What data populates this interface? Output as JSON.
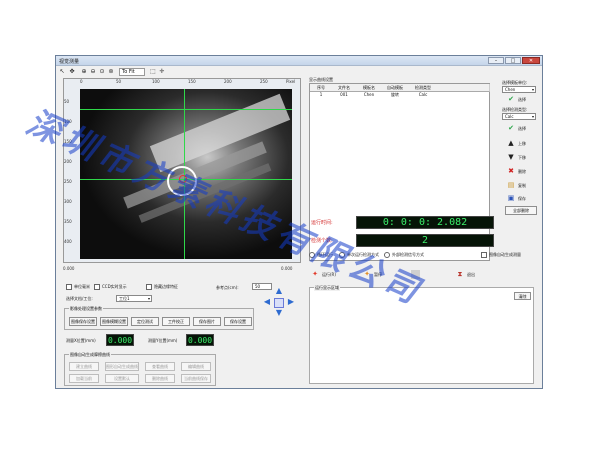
{
  "window": {
    "title": "视觉测量"
  },
  "toolbar": {
    "zoom_value": "To Fit"
  },
  "image": {
    "ruler_top": [
      "0",
      "50",
      "100",
      "150",
      "200",
      "250",
      "Pixel"
    ],
    "ruler_left": [
      "50",
      "100",
      "150",
      "200",
      "250",
      "300",
      "350",
      "400"
    ],
    "coords_left": "0.000",
    "coords_right": "0.000"
  },
  "left_panel": {
    "chk_unit": "单位毫米",
    "chk_ccd_display": "CCD实时显示",
    "chk_edge": "隐藏边缘特征",
    "ref_label": "参考点(cm):",
    "ref_value": "50",
    "select_label": "选择文档/工位:",
    "select_value": "工位1",
    "group1_title": "影像处理设置参数",
    "buttons_row1": [
      "图像保存设置",
      "图像模糊设置",
      "定位测试",
      "工件校正",
      "保存图片",
      "保存设置"
    ],
    "measure_x_label": "测量X位置(mm)",
    "measure_x_value": "0.000",
    "measure_y_label": "测量Y位置(mm)",
    "measure_y_value": "0.000",
    "group2_title": "图像自动生成摩擦曲线",
    "buttons_row2": [
      "建立曲线",
      "图形自动生成曲线",
      "查看曲线",
      "编辑曲线"
    ],
    "buttons_row3": [
      "加载当前",
      "设置默认",
      "删除曲线",
      "当前曲线保存"
    ]
  },
  "right_panel": {
    "table_title": "显示曲线设置",
    "columns": [
      "序号",
      "文件名",
      "模板名",
      "自动模板",
      "检测类型"
    ],
    "rows": [
      [
        "1",
        "001",
        "Chen",
        "旋转",
        "Calc"
      ]
    ],
    "side_top_label": "选择模板单位:",
    "side_top_value": "Chen",
    "side_mid_label": "选择检测类型:",
    "side_mid_value": "Calc",
    "side_buttons": [
      "选择",
      "选择",
      "上移",
      "下移",
      "删除",
      "复制",
      "保存"
    ],
    "side_bottom_button": "全部删除",
    "time_label": "运行时间:",
    "time_value": "0: 0: 0: 2.082",
    "count_label": "检测个数:",
    "count_value": "2",
    "radio_cycle": "循环运行",
    "radio_manual": "单次运行检测方式",
    "radio_sensor": "外部检测信号方式",
    "chk_auto": "图像自动生成测量",
    "btn_run": "运行(R)",
    "btn_stop": "暂停",
    "btn_close": "退出",
    "log_title": "运行显示区域",
    "log_button": "清除"
  },
  "watermark": "深圳市方素科技有限公司"
}
